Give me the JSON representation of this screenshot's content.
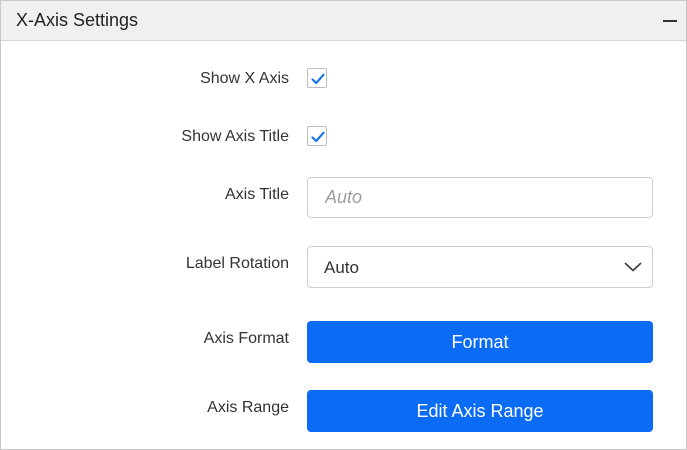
{
  "panel": {
    "title": "X-Axis Settings",
    "collapse_icon": "minus-icon"
  },
  "settings": {
    "show_x_axis": {
      "label": "Show X Axis",
      "checked": true
    },
    "show_axis_title": {
      "label": "Show Axis Title",
      "checked": true
    },
    "axis_title": {
      "label": "Axis Title",
      "value": "",
      "placeholder": "Auto"
    },
    "label_rotation": {
      "label": "Label Rotation",
      "selected": "Auto",
      "icon": "chevron-down-icon"
    },
    "axis_format": {
      "label": "Axis Format",
      "button_label": "Format"
    },
    "axis_range": {
      "label": "Axis Range",
      "button_label": "Edit Axis Range"
    }
  },
  "colors": {
    "accent": "#0a6cf5",
    "check": "#1a73e8",
    "header_bg": "#f0f0f0"
  }
}
